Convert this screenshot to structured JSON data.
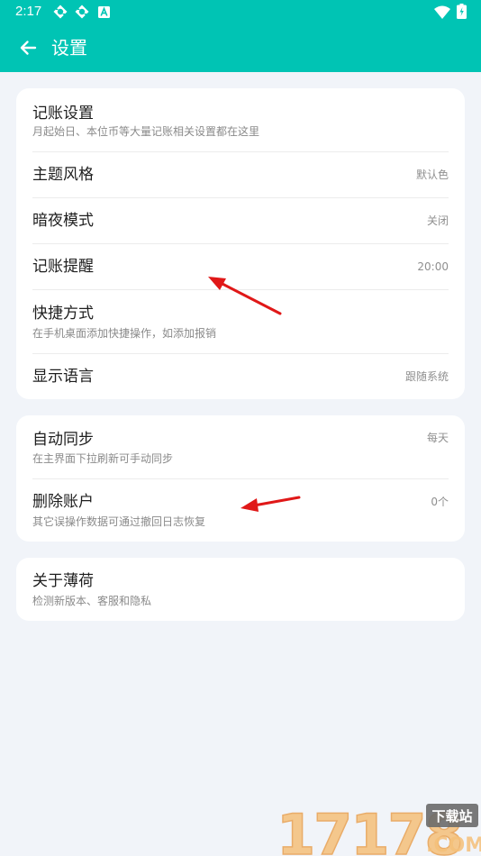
{
  "status": {
    "time": "2:17",
    "icons": [
      "sync-icon",
      "sync-icon",
      "app-a-icon",
      "wifi-icon",
      "battery-icon"
    ]
  },
  "appbar": {
    "back_icon": "arrow-left-icon",
    "title": "设置"
  },
  "groups": [
    {
      "items": [
        {
          "title": "记账设置",
          "subtitle": "月起始日、本位币等大量记账相关设置都在这里"
        },
        {
          "title": "主题风格",
          "value": "默认色"
        },
        {
          "title": "暗夜模式",
          "value": "关闭"
        },
        {
          "title": "记账提醒",
          "value": "20:00"
        },
        {
          "title": "快捷方式",
          "subtitle": "在手机桌面添加快捷操作，如添加报销"
        },
        {
          "title": "显示语言",
          "value": "跟随系统"
        }
      ]
    },
    {
      "items": [
        {
          "title": "自动同步",
          "subtitle": "在主界面下拉刷新可手动同步",
          "value": "每天"
        },
        {
          "title": "删除账户",
          "subtitle": "其它误操作数据可通过撤回日志恢复",
          "value": "0个"
        }
      ]
    },
    {
      "items": [
        {
          "title": "关于薄荷",
          "subtitle": "检测新版本、客服和隐私"
        }
      ]
    }
  ],
  "watermark": {
    "number": "17178",
    "badge": "下载站",
    "domain": ".COM"
  },
  "colors": {
    "primary": "#00c4b4",
    "background": "#f1f4f9",
    "card": "#ffffff",
    "annotation_arrow": "#e01818"
  }
}
